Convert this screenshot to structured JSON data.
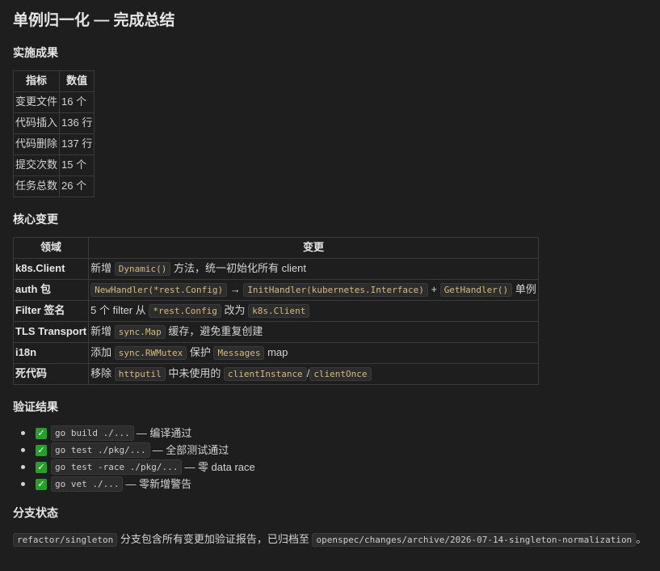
{
  "title": "单例归一化 — 完成总结",
  "results": {
    "heading": "实施成果",
    "headers": [
      "指标",
      "数值"
    ],
    "rows": [
      {
        "metric": "变更文件",
        "value": "16 个"
      },
      {
        "metric": "代码插入",
        "value": "136 行"
      },
      {
        "metric": "代码删除",
        "value": "137 行"
      },
      {
        "metric": "提交次数",
        "value": "15 个"
      },
      {
        "metric": "任务总数",
        "value": "26 个"
      }
    ]
  },
  "core": {
    "heading": "核心变更",
    "headers": [
      "领域",
      "变更"
    ],
    "rows": [
      {
        "area": "k8s.Client",
        "t1": "新增 ",
        "c1": "Dynamic()",
        "t2": " 方法，统一初始化所有 client"
      },
      {
        "area": "auth 包",
        "c1": "NewHandler(*rest.Config)",
        "t1": " → ",
        "c2": "InitHandler(kubernetes.Interface)",
        "t2": " + ",
        "c3": "GetHandler()",
        "t3": " 单例"
      },
      {
        "area": "Filter 签名",
        "t1": "5 个 filter 从 ",
        "c1": "*rest.Config",
        "t2": " 改为 ",
        "c2": "k8s.Client"
      },
      {
        "area": "TLS Transport",
        "t1": "新增 ",
        "c1": "sync.Map",
        "t2": " 缓存，避免重复创建"
      },
      {
        "area": "i18n",
        "t1": "添加 ",
        "c1": "sync.RWMutex",
        "t2": " 保护 ",
        "c2": "Messages",
        "t3": " map"
      },
      {
        "area": "死代码",
        "t1": "移除 ",
        "c1": "httputil",
        "t2": " 中未使用的 ",
        "c2": "clientInstance",
        "t3": "/",
        "c3": "clientOnce"
      }
    ]
  },
  "verify": {
    "heading": "验证结果",
    "items": [
      {
        "check": "✓",
        "cmd": "go build ./...",
        "text": "— 编译通过"
      },
      {
        "check": "✓",
        "cmd": "go test ./pkg/...",
        "text": "— 全部测试通过"
      },
      {
        "check": "✓",
        "cmd": "go test -race ./pkg/...",
        "text": "— 零 data race"
      },
      {
        "check": "✓",
        "cmd": "go vet ./...",
        "text": "— 零新增警告"
      }
    ]
  },
  "branch": {
    "heading": "分支状态",
    "name": "refactor/singleton",
    "text1": " 分支包含所有变更加验证报告，已归档至 ",
    "path": "openspec/changes/archive/2026-07-14-singleton-normalization",
    "text2": "。"
  },
  "colors": {
    "background": "#1e1e1e",
    "text": "#d4d4d4",
    "code_text": "#d7ba7d",
    "code_background": "#2d2d2d",
    "check": "#27a02b"
  }
}
